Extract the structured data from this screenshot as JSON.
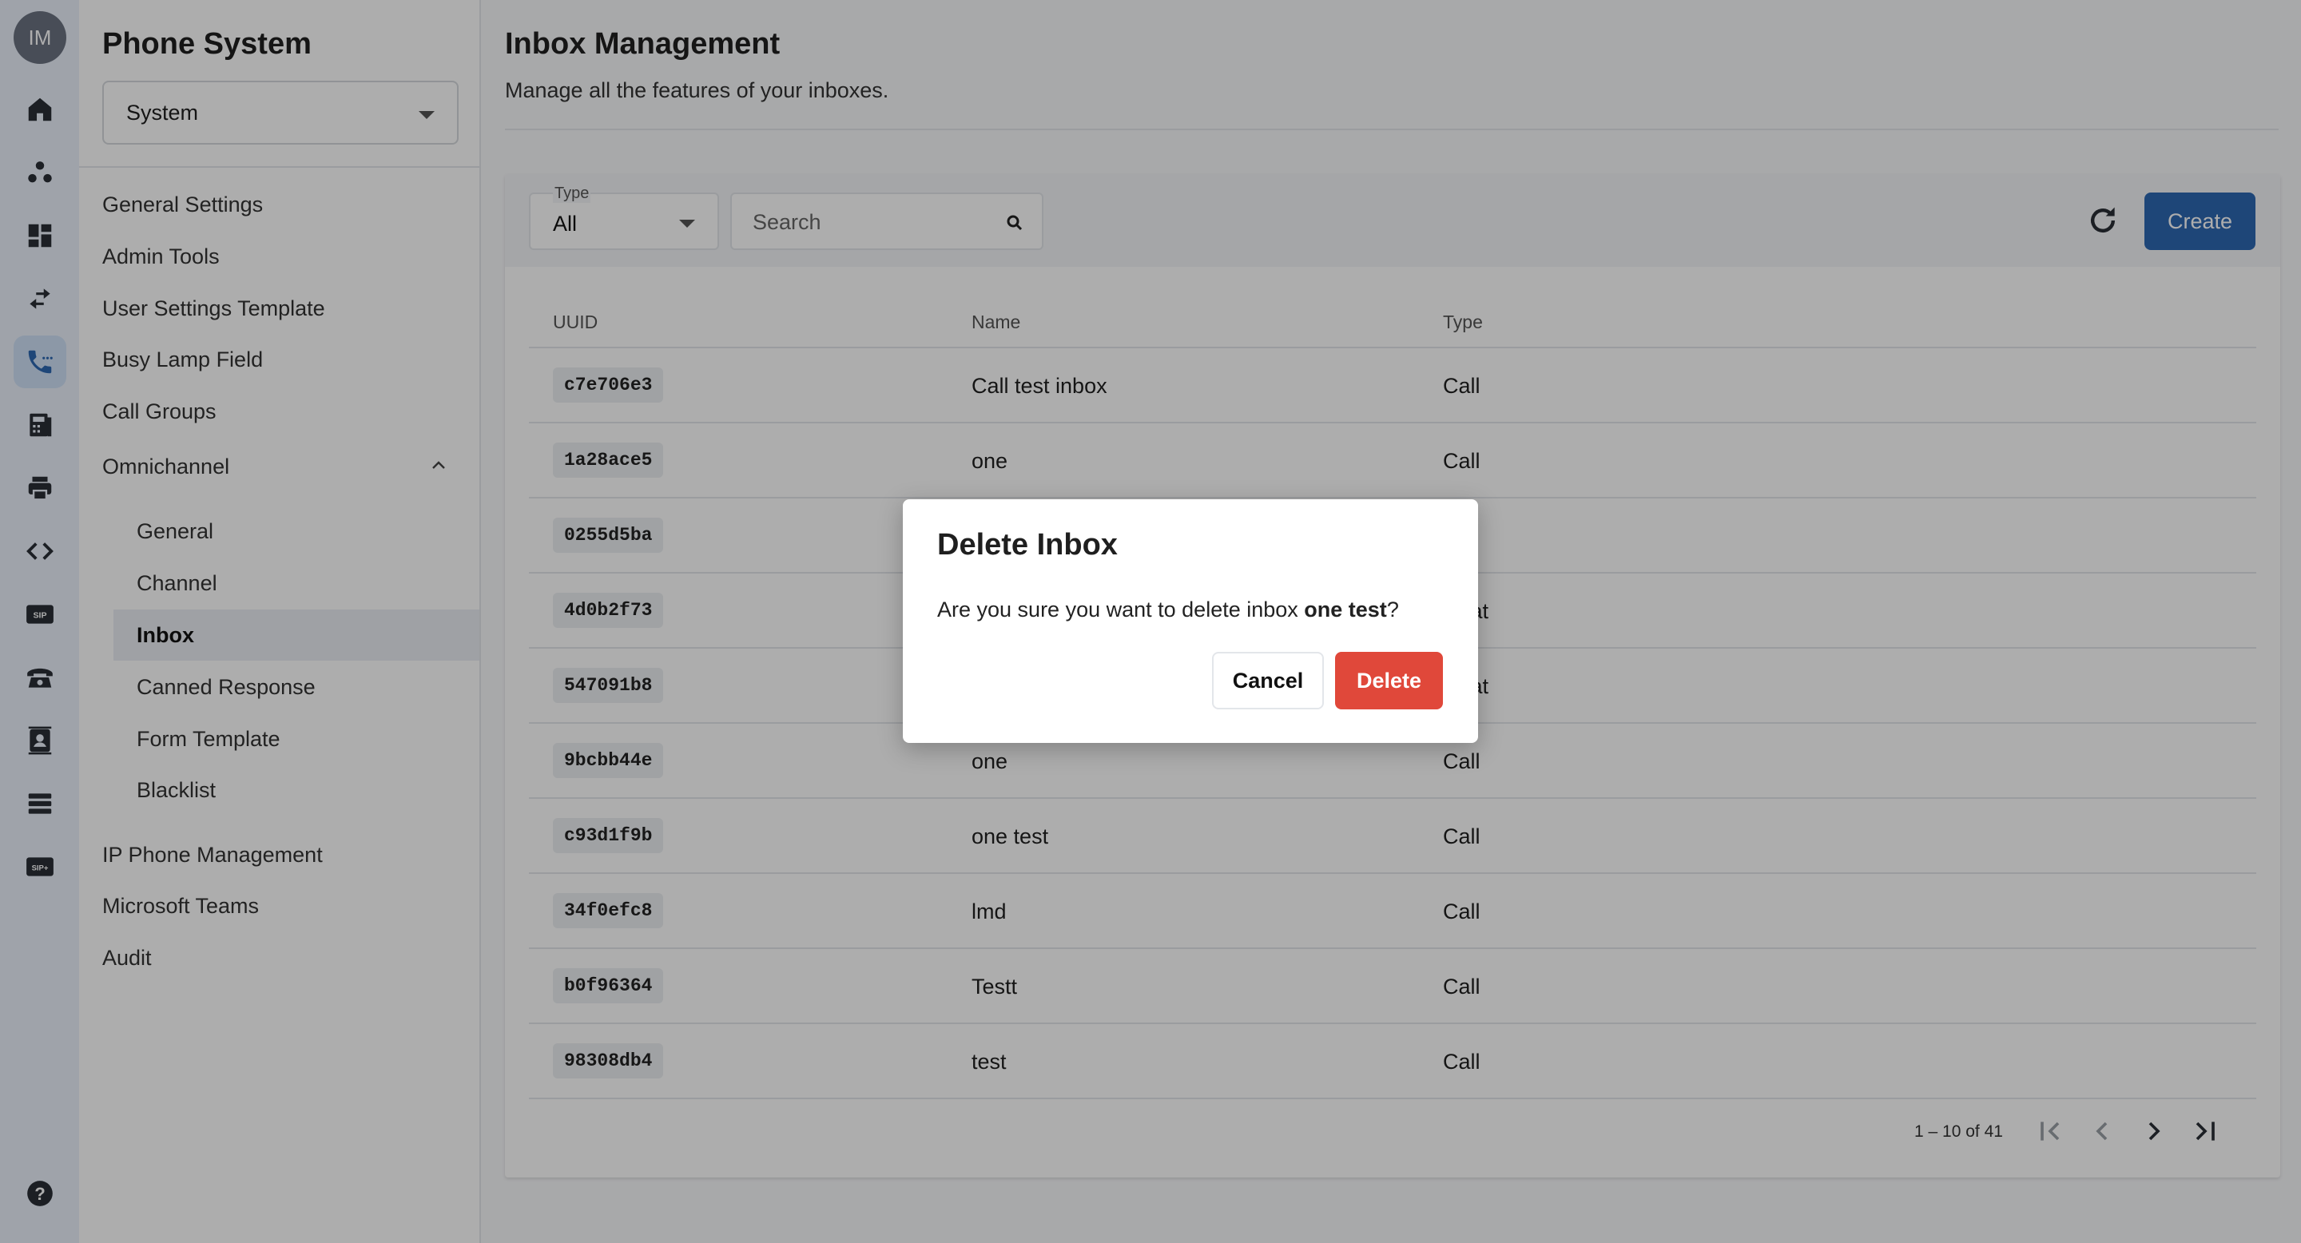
{
  "user": {
    "initials": "IM"
  },
  "rail": {
    "icons": [
      "home-icon",
      "groups-icon",
      "dashboard-icon",
      "transfer-icon",
      "phone-icon",
      "fax-icon",
      "printer-icon",
      "code-icon",
      "sip-icon",
      "desk-phone-icon",
      "contacts-icon",
      "server-icon",
      "sip-plus-icon",
      "help-icon"
    ],
    "sip_label": "SIP",
    "sip_plus_label": "SIP+"
  },
  "subnav": {
    "title": "Phone System",
    "selector": "System",
    "items": {
      "general_settings": "General Settings",
      "admin_tools": "Admin Tools",
      "user_settings_template": "User Settings Template",
      "busy_lamp_field": "Busy Lamp Field",
      "call_groups": "Call Groups",
      "omnichannel": "Omnichannel",
      "ip_phone_management": "IP Phone Management",
      "microsoft_teams": "Microsoft Teams",
      "audit": "Audit"
    },
    "omnichannel_children": {
      "general": "General",
      "channel": "Channel",
      "inbox": "Inbox",
      "canned_response": "Canned Response",
      "form_template": "Form Template",
      "blacklist": "Blacklist"
    }
  },
  "page": {
    "title": "Inbox Management",
    "subtitle": "Manage all the features of your inboxes."
  },
  "toolbar": {
    "type_label": "Type",
    "type_value": "All",
    "search_placeholder": "Search",
    "create_label": "Create"
  },
  "table": {
    "headers": {
      "uuid": "UUID",
      "name": "Name",
      "type": "Type"
    },
    "rows": [
      {
        "uuid": "c7e706e3",
        "name": "Call test inbox",
        "type": "Call"
      },
      {
        "uuid": "1a28ace5",
        "name": "one",
        "type": "Call"
      },
      {
        "uuid": "0255d5ba",
        "name": "",
        "type": ""
      },
      {
        "uuid": "4d0b2f73",
        "name": "",
        "type": "Chat"
      },
      {
        "uuid": "547091b8",
        "name": "",
        "type": "Chat"
      },
      {
        "uuid": "9bcbb44e",
        "name": "one",
        "type": "Call"
      },
      {
        "uuid": "c93d1f9b",
        "name": "one test",
        "type": "Call"
      },
      {
        "uuid": "34f0efc8",
        "name": "lmd",
        "type": "Call"
      },
      {
        "uuid": "b0f96364",
        "name": "Testt",
        "type": "Call"
      },
      {
        "uuid": "98308db4",
        "name": "test",
        "type": "Call"
      }
    ]
  },
  "pagination": {
    "range": "1 – 10 of 41"
  },
  "dialog": {
    "title": "Delete Inbox",
    "message_prefix": "Are you sure you want to delete inbox ",
    "inbox_name": "one test",
    "message_suffix": "?",
    "cancel_label": "Cancel",
    "delete_label": "Delete"
  },
  "colors": {
    "accent": "#2d67b2",
    "danger": "#e0483a",
    "rail_bg": "#eaf1fb",
    "rail_active": "#cfe0f6"
  }
}
